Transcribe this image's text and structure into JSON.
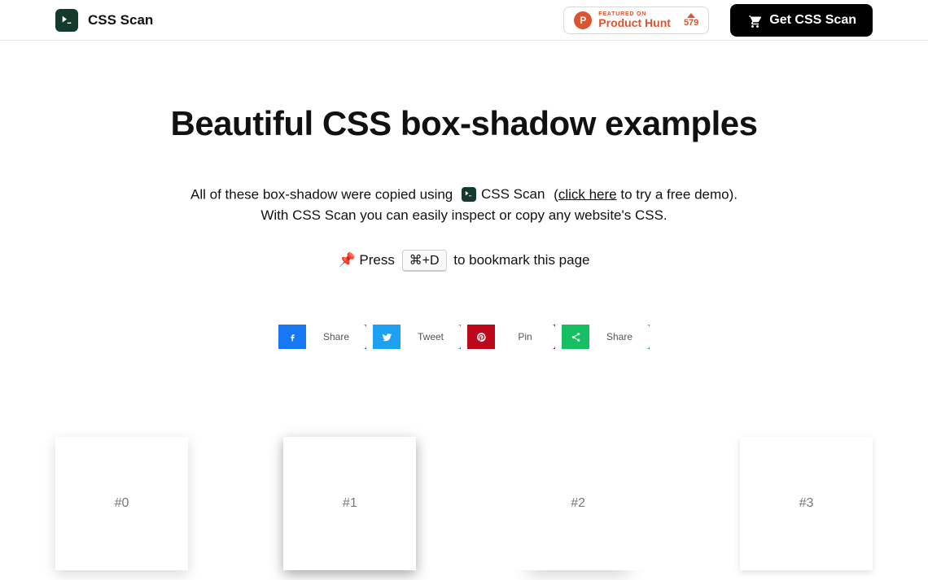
{
  "brand": {
    "name": "CSS Scan"
  },
  "product_hunt": {
    "featured": "Featured on",
    "name": "Product Hunt",
    "votes": "579"
  },
  "cta": {
    "label": "Get CSS Scan"
  },
  "title": "Beautiful CSS box-shadow examples",
  "intro": {
    "prefix": "All of these box-shadow were copied using ",
    "tool": "CSS Scan",
    "open_paren": " (",
    "click_here": "click here",
    "after_click": " to try a free demo).",
    "line2": "With CSS Scan you can easily inspect or copy any website's CSS."
  },
  "hint": {
    "pin": "📌",
    "press": "Press",
    "key": "⌘+D",
    "after": "to bookmark this page"
  },
  "share": {
    "facebook": "Share",
    "twitter": "Tweet",
    "pinterest": "Pin",
    "sharethis": "Share"
  },
  "cards": [
    "#0",
    "#1",
    "#2",
    "#3"
  ]
}
